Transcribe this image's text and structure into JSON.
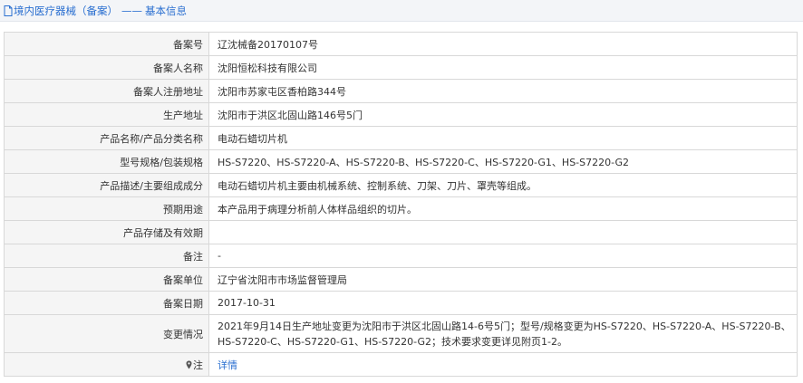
{
  "header": {
    "title": "境内医疗器械（备案）",
    "separator": "——",
    "subtitle": "基本信息"
  },
  "rows": [
    {
      "label": "备案号",
      "value": "辽沈械备20170107号"
    },
    {
      "label": "备案人名称",
      "value": "沈阳恒松科技有限公司"
    },
    {
      "label": "备案人注册地址",
      "value": "沈阳市苏家屯区香柏路344号"
    },
    {
      "label": "生产地址",
      "value": "沈阳市于洪区北固山路146号5门"
    },
    {
      "label": "产品名称/产品分类名称",
      "value": "电动石蜡切片机"
    },
    {
      "label": "型号规格/包装规格",
      "value": "HS-S7220、HS-S7220-A、HS-S7220-B、HS-S7220-C、HS-S7220-G1、HS-S7220-G2"
    },
    {
      "label": "产品描述/主要组成成分",
      "value": "电动石蜡切片机主要由机械系统、控制系统、刀架、刀片、罩壳等组成。"
    },
    {
      "label": "预期用途",
      "value": "本产品用于病理分析前人体样品组织的切片。"
    },
    {
      "label": "产品存储及有效期",
      "value": ""
    },
    {
      "label": "备注",
      "value": "-"
    },
    {
      "label": "备案单位",
      "value": "辽宁省沈阳市市场监督管理局"
    },
    {
      "label": "备案日期",
      "value": "2017-10-31"
    },
    {
      "label": "变更情况",
      "value": "2021年9月14日生产地址变更为沈阳市于洪区北固山路14-6号5门；型号/规格变更为HS-S7220、HS-S7220-A、HS-S7220-B、HS-S7220-C、HS-S7220-G1、HS-S7220-G2；技术要求变更详见附页1-2。"
    }
  ],
  "note": {
    "label": "注",
    "link_text": "详情"
  },
  "colors": {
    "link": "#2a6fd0",
    "label_bg": "#f5f5f5",
    "border": "#d8d8d8"
  },
  "icons": {
    "title": "document-icon",
    "note": "pin-icon"
  }
}
